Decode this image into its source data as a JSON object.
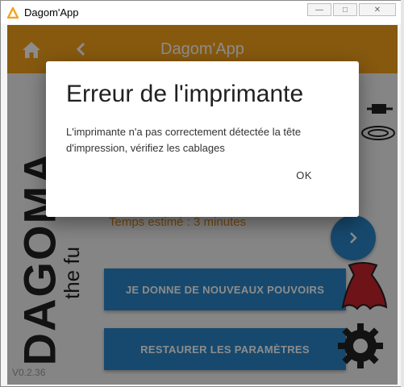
{
  "window": {
    "title": "Dagom'App",
    "minimize_glyph": "—",
    "maximize_glyph": "□",
    "close_glyph": "✕"
  },
  "appbar": {
    "title": "Dagom'App",
    "home_icon": "home-icon",
    "back_icon": "chevron-left-icon",
    "color": "#f5a21c"
  },
  "brand": {
    "name": "DAGOMA",
    "tagline": "the fu",
    "version": "V0.2.36"
  },
  "main": {
    "estimate": "Temps estimé : 3 minutes",
    "button_powers": "JE DONNE DE NOUVEAUX POUVOIRS",
    "button_restore": "RESTAURER LES PARAMÈTRES",
    "accent": "#2a86c9"
  },
  "dialog": {
    "title": "Erreur de l'imprimante",
    "message": "L'imprimante n'a pas correctement détectée la tête d'impression, vérifiez les cablages",
    "ok_label": "OK"
  }
}
